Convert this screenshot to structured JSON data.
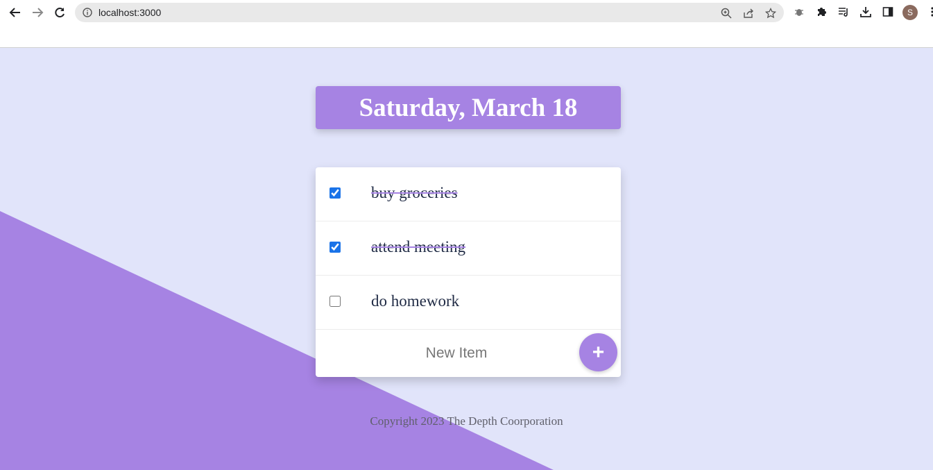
{
  "browser": {
    "url": "localhost:3000",
    "profile_initial": "S",
    "icons": [
      "back-icon",
      "forward-icon",
      "reload-icon",
      "info-icon",
      "zoom-icon",
      "share-icon",
      "star-icon",
      "bug-icon",
      "puzzle-icon",
      "media-icon",
      "download-icon",
      "sidepanel-icon",
      "more-icon"
    ]
  },
  "page": {
    "date_title": "Saturday, March 18",
    "items": [
      {
        "label": "buy groceries",
        "checked": true
      },
      {
        "label": "attend meeting",
        "checked": true
      },
      {
        "label": "do homework",
        "checked": false
      }
    ],
    "new_item_placeholder": "New Item",
    "add_button_label": "+",
    "footer": "Copyright 2023 The Depth Coorporation"
  },
  "colors": {
    "accent": "#a683e3",
    "background": "#e1e4fa"
  }
}
